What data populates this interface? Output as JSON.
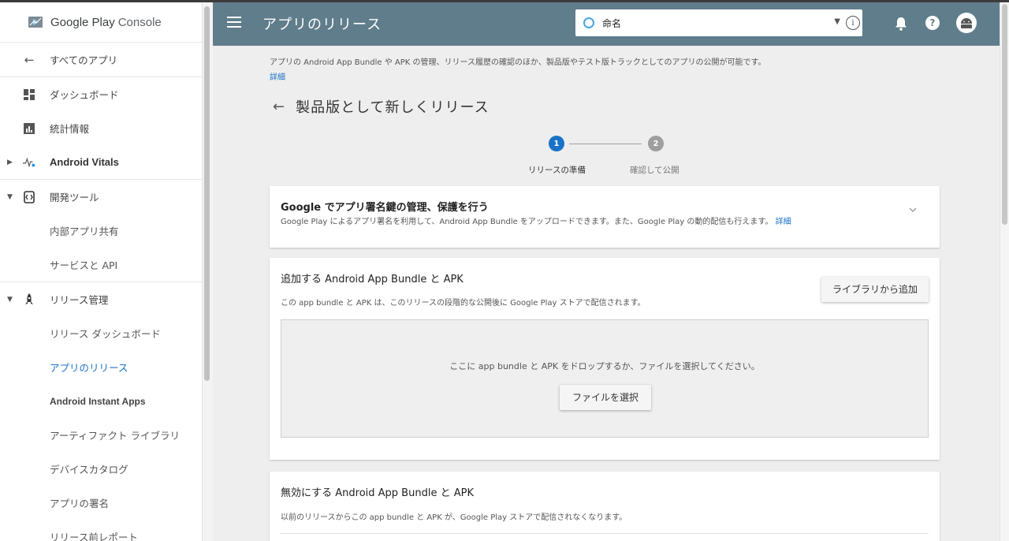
{
  "brand": {
    "name": "Google Play",
    "suffix": "Console"
  },
  "sidebar": {
    "items": [
      {
        "label": "すべてのアプリ"
      },
      {
        "label": "ダッシュボード"
      },
      {
        "label": "統計情報"
      },
      {
        "label": "Android Vitals"
      },
      {
        "label": "開発ツール"
      },
      {
        "label": "内部アプリ共有"
      },
      {
        "label": "サービスと API"
      },
      {
        "label": "リリース管理"
      },
      {
        "label": "リリース ダッシュボード"
      },
      {
        "label": "アプリのリリース"
      },
      {
        "label": "Android Instant Apps"
      },
      {
        "label": "アーティファクト ライブラリ"
      },
      {
        "label": "デバイスカタログ"
      },
      {
        "label": "アプリの署名"
      },
      {
        "label": "リリース前レポート"
      }
    ]
  },
  "header": {
    "title": "アプリのリリース",
    "app_selector": {
      "value": "命名"
    }
  },
  "main": {
    "intro": "アプリの Android App Bundle や APK の管理、リリース履歴の確認のほか、製品版やテスト版トラックとしてのアプリの公開が可能です。",
    "intro_link": "詳細",
    "page_title": "製品版として新しくリリース",
    "steps": [
      {
        "number": "1",
        "label": "リリースの準備",
        "color": "#1a73c8"
      },
      {
        "number": "2",
        "label": "確認して公開",
        "color": "#9e9e9e"
      }
    ],
    "signing_card": {
      "title": "Google でアプリ署名鍵の管理、保護を行う",
      "desc": "Google Play によるアプリ署名を利用して、Android App Bundle をアップロードできます。また、Google Play の動的配信も行えます。",
      "link": "詳細"
    },
    "add_card": {
      "title": "追加する Android App Bundle と APK",
      "desc": "この app bundle と APK は、このリリースの段階的な公開後に Google Play ストアで配信されます。",
      "library_button": "ライブラリから追加",
      "drop_text": "ここに app bundle と APK をドロップするか、ファイルを選択してください。",
      "file_button": "ファイルを選択"
    },
    "disable_card": {
      "title": "無効にする Android App Bundle と APK",
      "desc": "以前のリリースからこの app bundle と APK が、Google Play ストアで配信されなくなります。"
    }
  },
  "colors": {
    "topbar": "#607d8b",
    "link": "#1a73c8",
    "step_active": "#1a73c8",
    "step_inactive": "#9e9e9e"
  }
}
